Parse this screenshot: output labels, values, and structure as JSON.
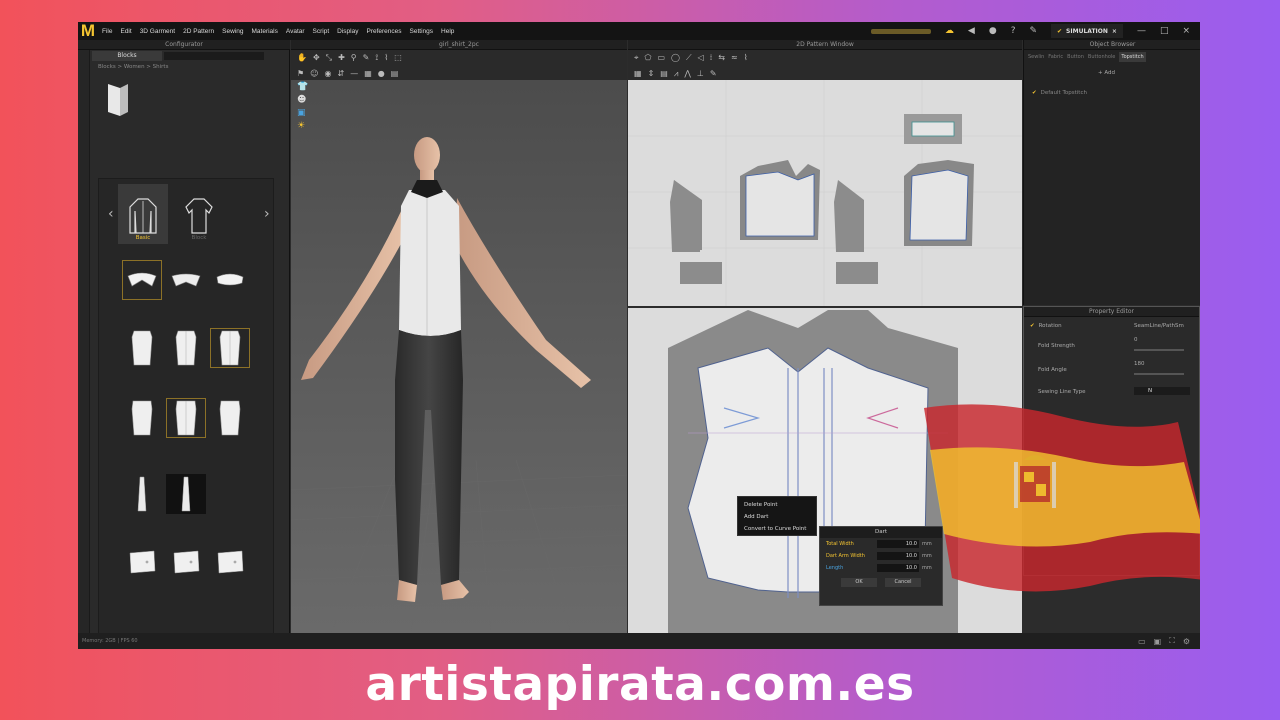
{
  "menu": {
    "logo": "M",
    "items": [
      "File",
      "Edit",
      "3D Garment",
      "2D Pattern",
      "Sewing",
      "Materials",
      "Avatar",
      "Script",
      "Display",
      "Preferences",
      "Settings",
      "Help"
    ],
    "simulation_label": "SIMULATION"
  },
  "library": {
    "panel_title": "Configurator",
    "tab": "Blocks",
    "breadcrumb": "Blocks > Women > Shirts",
    "cfg_tabs": [
      "Basic",
      "Block"
    ]
  },
  "viewport_3d": {
    "title": "girl_shirt_2pc"
  },
  "pattern_window": {
    "title": "2D Pattern Window"
  },
  "object_browser": {
    "title": "Object Browser",
    "tabs": [
      "Sewlin",
      "Fabric",
      "Button",
      "Buttonhole",
      "Topstitch"
    ],
    "add_label": "+ Add",
    "item": "Default Topstitch"
  },
  "property_editor": {
    "title": "Property Editor",
    "header_left": "Rotation",
    "header_right": "SeamLine/PathSm",
    "rows": [
      {
        "label": "Fold Strength",
        "value": "0"
      },
      {
        "label": "Fold Angle",
        "value": "180"
      },
      {
        "label": "Sewing Line Type",
        "value": "N"
      }
    ]
  },
  "context_menu": {
    "items": [
      "Delete Point",
      "Add Dart",
      "Convert to Curve Point"
    ]
  },
  "dart_dialog": {
    "title": "Dart",
    "rows": [
      {
        "label": "Total Width",
        "value": "10.0",
        "unit": "mm"
      },
      {
        "label": "Dart Arm Width",
        "value": "10.0",
        "unit": "mm"
      },
      {
        "label": "Length",
        "value": "10.0",
        "unit": "mm"
      }
    ],
    "ok": "OK",
    "cancel": "Cancel"
  },
  "status": {
    "text": "Memory: 2GB  |  FPS 60"
  },
  "website": "artistapirata.com.es",
  "colors": {
    "accent": "#f4c431",
    "flag_red": "#c8272d",
    "flag_yellow": "#f2c12e"
  }
}
